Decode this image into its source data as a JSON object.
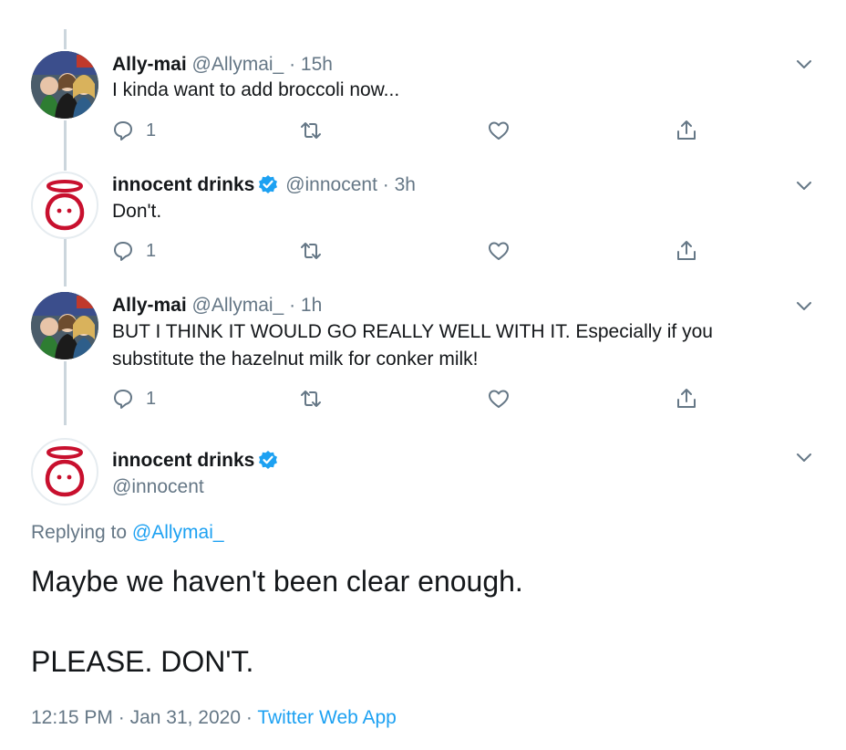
{
  "thread": [
    {
      "name": "Ally-mai",
      "handle": "@Allymai_",
      "time": "15h",
      "text": "I kinda want to add broccoli now...",
      "reply_count": "1",
      "verified": false
    },
    {
      "name": "innocent drinks",
      "handle": "@innocent",
      "time": "3h",
      "text": "Don't.",
      "reply_count": "1",
      "verified": true
    },
    {
      "name": "Ally-mai",
      "handle": "@Allymai_",
      "time": "1h",
      "text_line1": "BUT I THINK IT WOULD GO REALLY WELL WITH IT. Especially if you",
      "text_line2": "substitute the hazelnut milk for conker milk!",
      "reply_count": "1",
      "verified": false
    }
  ],
  "main_tweet": {
    "name": "innocent drinks",
    "handle": "@innocent",
    "replying_prefix": "Replying to",
    "replying_handle": "@Allymai_",
    "text_line1": "Maybe we haven't been clear enough.",
    "text_line2": "PLEASE. DON'T.",
    "time": "12:15 PM",
    "date": "Jan 31, 2020",
    "source": "Twitter Web App"
  },
  "separator": "·",
  "colors": {
    "accent": "#1da1f2",
    "muted": "#657786",
    "text": "#14171a",
    "brand_red": "#c8102e"
  },
  "icons": [
    "reply-icon",
    "retweet-icon",
    "like-icon",
    "share-icon",
    "verified-badge-icon",
    "chevron-down-icon"
  ]
}
